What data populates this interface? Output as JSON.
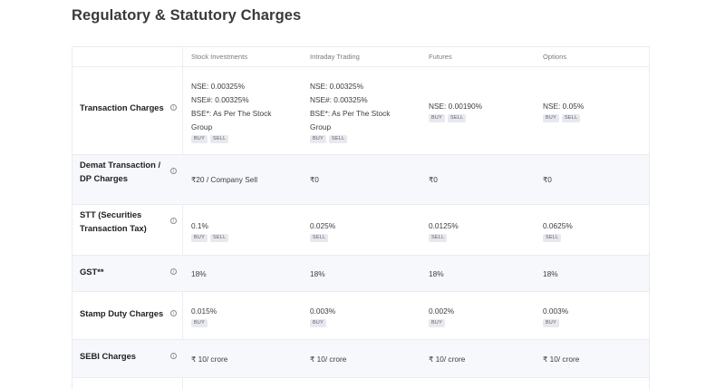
{
  "title": "Regulatory & Statutory Charges",
  "columns": [
    "Stock Investments",
    "Intraday Trading",
    "Futures",
    "Options"
  ],
  "rows": [
    {
      "label": "Transaction Charges",
      "cells": [
        {
          "lines": [
            "NSE: 0.00325%",
            "NSE#: 0.00325%",
            "BSE*: As Per The Stock",
            "Group"
          ],
          "tags": [
            "BUY",
            "SELL"
          ]
        },
        {
          "lines": [
            "NSE: 0.00325%",
            "NSE#: 0.00325%",
            "BSE*: As Per The Stock",
            "Group"
          ],
          "tags": [
            "BUY",
            "SELL"
          ]
        },
        {
          "lines": [
            "NSE: 0.00190%"
          ],
          "tags": [
            "BUY",
            "SELL"
          ]
        },
        {
          "lines": [
            "NSE: 0.05%"
          ],
          "tags": [
            "BUY",
            "SELL"
          ]
        }
      ]
    },
    {
      "label": "Demat Transaction / DP Charges",
      "cells": [
        {
          "lines": [
            "₹20 / Company Sell"
          ],
          "tags": []
        },
        {
          "lines": [
            "₹0"
          ],
          "tags": []
        },
        {
          "lines": [
            "₹0"
          ],
          "tags": []
        },
        {
          "lines": [
            "₹0"
          ],
          "tags": []
        }
      ]
    },
    {
      "label": "STT (Securities Transaction Tax)",
      "cells": [
        {
          "lines": [
            "0.1%"
          ],
          "tags": [
            "BUY",
            "SELL"
          ]
        },
        {
          "lines": [
            "0.025%"
          ],
          "tags": [
            "SELL"
          ]
        },
        {
          "lines": [
            "0.0125%"
          ],
          "tags": [
            "SELL"
          ]
        },
        {
          "lines": [
            "0.0625%"
          ],
          "tags": [
            "SELL"
          ]
        }
      ]
    },
    {
      "label": "GST**",
      "cells": [
        {
          "lines": [
            "18%"
          ],
          "tags": []
        },
        {
          "lines": [
            "18%"
          ],
          "tags": []
        },
        {
          "lines": [
            "18%"
          ],
          "tags": []
        },
        {
          "lines": [
            "18%"
          ],
          "tags": []
        }
      ]
    },
    {
      "label": "Stamp Duty Charges",
      "cells": [
        {
          "lines": [
            "0.015%"
          ],
          "tags": [
            "BUY"
          ]
        },
        {
          "lines": [
            "0.003%"
          ],
          "tags": [
            "BUY"
          ]
        },
        {
          "lines": [
            "0.002%"
          ],
          "tags": [
            "BUY"
          ]
        },
        {
          "lines": [
            "0.003%"
          ],
          "tags": [
            "BUY"
          ]
        }
      ]
    },
    {
      "label": "SEBI Charges",
      "cells": [
        {
          "lines": [
            "₹ 10/ crore"
          ],
          "tags": []
        },
        {
          "lines": [
            "₹ 10/ crore"
          ],
          "tags": []
        },
        {
          "lines": [
            "₹ 10/ crore"
          ],
          "tags": []
        },
        {
          "lines": [
            "₹ 10/ crore"
          ],
          "tags": []
        }
      ]
    }
  ],
  "info_icon": "info-icon"
}
